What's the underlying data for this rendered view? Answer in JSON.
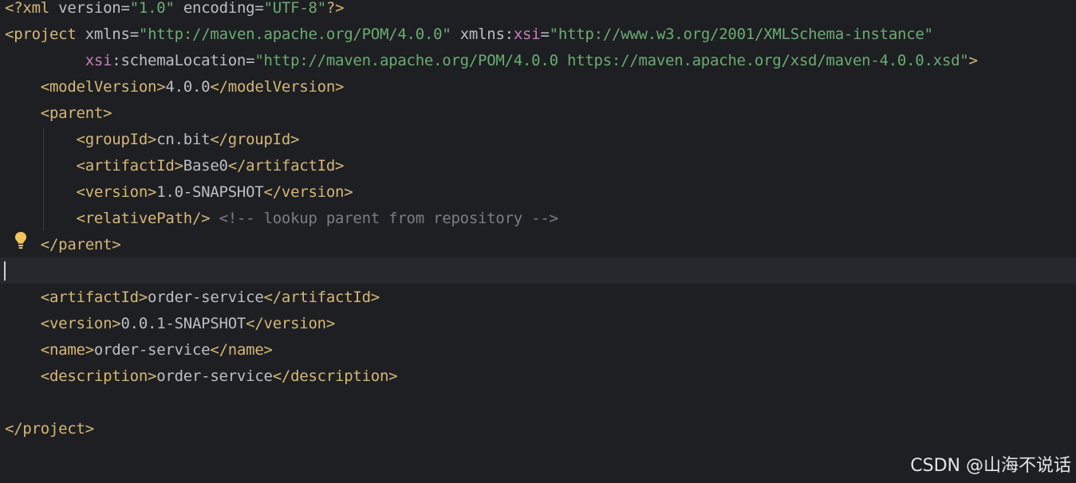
{
  "code": {
    "l1": {
      "open": "<?",
      "tag": "xml",
      "sp1": " ",
      "attr1": "version",
      "eq1": "=",
      "val1": "\"1.0\"",
      "sp2": " ",
      "attr2": "encoding",
      "eq2": "=",
      "val2": "\"UTF-8\"",
      "close": "?>"
    },
    "l2": {
      "open": "<",
      "tag": "project",
      "sp1": " ",
      "attr1": "xmlns",
      "eq1": "=",
      "val1": "\"http://maven.apache.org/POM/4.0.0\"",
      "sp2": " ",
      "attr2": "xmlns:",
      "ns": "xsi",
      "eq2": "=",
      "val2": "\"http://www.w3.org/2001/XMLSchema-instance\""
    },
    "l3": {
      "indent": "         ",
      "ns": "xsi",
      "attr": ":schemaLocation",
      "eq": "=",
      "val": "\"http://maven.apache.org/POM/4.0.0 https://maven.apache.org/xsd/maven-4.0.0.xsd\"",
      "close": ">"
    },
    "l4": {
      "indent": "    ",
      "open": "<modelVersion>",
      "text": "4.0.0",
      "close": "</modelVersion>"
    },
    "l5": {
      "indent": "    ",
      "open": "<parent>"
    },
    "l6": {
      "indent": "        ",
      "open": "<groupId>",
      "text": "cn.bit",
      "close": "</groupId>"
    },
    "l7": {
      "indent": "        ",
      "open": "<artifactId>",
      "text": "Base0",
      "close": "</artifactId>"
    },
    "l8": {
      "indent": "        ",
      "open": "<version>",
      "text": "1.0-SNAPSHOT",
      "close": "</version>"
    },
    "l9": {
      "indent": "        ",
      "open": "<relativePath/>",
      "sp": " ",
      "comment": "<!-- lookup parent from repository -->"
    },
    "l10": {
      "indent": "    ",
      "close": "</parent>"
    },
    "l12": {
      "indent": "    ",
      "open": "<artifactId>",
      "text": "order-service",
      "close": "</artifactId>"
    },
    "l13": {
      "indent": "    ",
      "open": "<version>",
      "text": "0.0.1-SNAPSHOT",
      "close": "</version>"
    },
    "l14": {
      "indent": "    ",
      "open": "<name>",
      "text": "order-service",
      "close": "</name>"
    },
    "l15": {
      "indent": "    ",
      "open": "<description>",
      "text": "order-service",
      "close": "</description>"
    },
    "l17": {
      "close": "</project>"
    }
  },
  "gutter": {
    "bulb_icon": "lightbulb-icon"
  },
  "watermark": "CSDN @山海不说话",
  "colors": {
    "background": "#1e1f22",
    "current_line": "#26282e",
    "tag": "#d5b778",
    "attribute": "#bcbec4",
    "namespace": "#c77dbb",
    "string": "#6aab73",
    "comment": "#7a7e85",
    "bulb": "#f2c55c"
  }
}
